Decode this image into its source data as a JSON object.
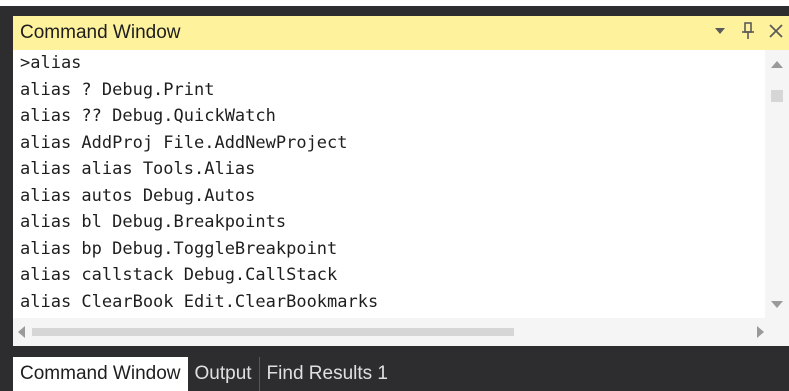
{
  "window": {
    "title": "Command Window",
    "icons": [
      "chevron-down-icon",
      "pin-icon",
      "close-icon"
    ]
  },
  "console": {
    "lines": [
      ">alias",
      "alias ? Debug.Print",
      "alias ?? Debug.QuickWatch",
      "alias AddProj File.AddNewProject",
      "alias alias Tools.Alias",
      "alias autos Debug.Autos",
      "alias bl Debug.Breakpoints",
      "alias bp Debug.ToggleBreakpoint",
      "alias callstack Debug.CallStack",
      "alias ClearBook Edit.ClearBookmarks"
    ]
  },
  "tabs": [
    {
      "label": "Command Window",
      "active": true
    },
    {
      "label": "Output",
      "active": false
    },
    {
      "label": "Find Results 1",
      "active": false
    }
  ],
  "colors": {
    "title_bg": "#fff29d",
    "dark_bg": "#2d2d30",
    "text": "#1e1e1e"
  }
}
